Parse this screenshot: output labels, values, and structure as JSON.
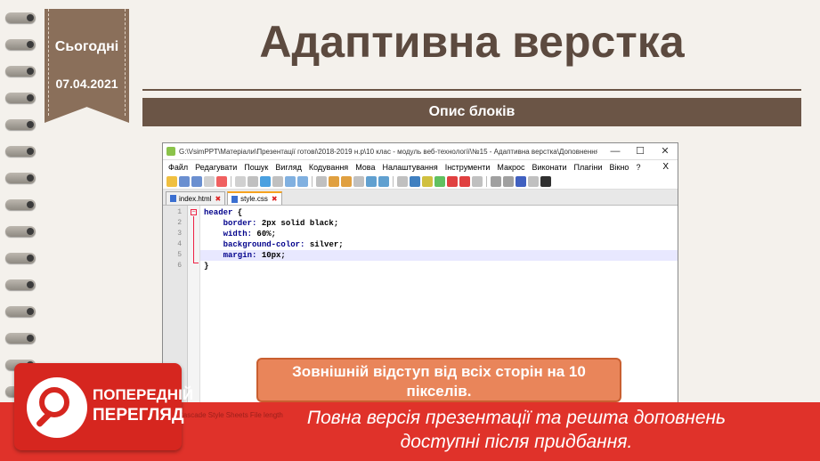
{
  "slide": {
    "today_label": "Сьогодні",
    "date": "07.04.2021",
    "title": "Адаптивна верстка",
    "subtitle": "Опис блоків"
  },
  "editor": {
    "window_title": "G:\\VsimPPT\\Матеріали\\Презентації готові\\2018-2019 н.р\\10 клас - модуль веб-технології\\№15 - Адаптивна верстка\\Доповнення\\Для...",
    "menu": [
      "Файл",
      "Редагувати",
      "Пошук",
      "Вигляд",
      "Кодування",
      "Мова",
      "Налаштування",
      "Інструменти",
      "Макрос",
      "Виконати",
      "Плагіни",
      "Вікно",
      "?"
    ],
    "menu_close": "X",
    "tabs": [
      {
        "label": "index.html",
        "active": false
      },
      {
        "label": "style.css",
        "active": true
      }
    ],
    "line_numbers": [
      "1",
      "2",
      "3",
      "4",
      "5",
      "6"
    ],
    "code": {
      "l1_sel": "header",
      "l1_brace": " {",
      "l2_prop": "border:",
      "l2_val": " 2px solid black;",
      "l3_prop": "width:",
      "l3_val": " 60%;",
      "l4_prop": "background-color:",
      "l4_val": " silver;",
      "l5_prop": "margin:",
      "l5_val": " 10px;",
      "l6": "}"
    },
    "status_text": "Cascade Style Sheets File     length"
  },
  "callout": {
    "line1": "Зовнішній відступ від всіх сторін на 10",
    "line2": "пікселів."
  },
  "preview": {
    "badge_line1": "ПОПЕРЕДНІЙ",
    "badge_line2": "ПЕРЕГЛЯД",
    "message_line1": "Повна версія презентації та решта доповнень",
    "message_line2": "доступні після придбання."
  }
}
